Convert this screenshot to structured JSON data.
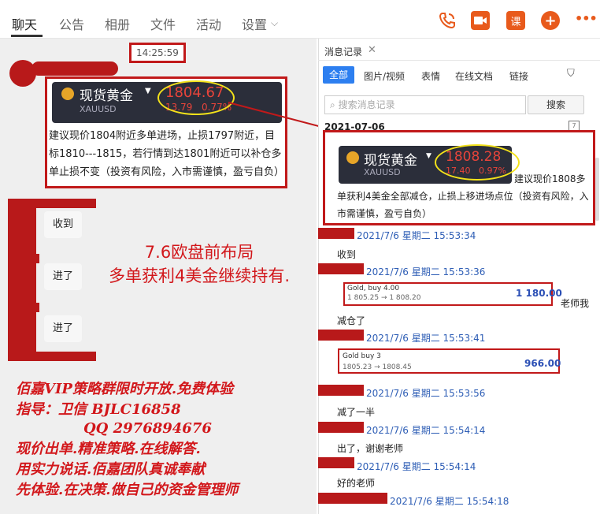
{
  "tabs": [
    "聊天",
    "公告",
    "相册",
    "文件",
    "活动",
    "设置"
  ],
  "tab_active": "聊天",
  "top_icons": {
    "ke": "课",
    "plus": "+",
    "more": "•••"
  },
  "chat": {
    "time": "14:25:59",
    "card": {
      "title": "现货黄金",
      "code": "XAUUSD",
      "price": "1804.67",
      "change": "13.79",
      "pct": "0.77%"
    },
    "message": "建议现价1804附近多单进场，止损1797附近，目标1810---1815，若行情到达1801附近可以补仓多单止损不变（投资有风险，入市需谨慎，盈亏自负）",
    "replies": [
      "收到",
      "进了",
      "进了"
    ],
    "overlay_line1": "7.6欧盘前布局",
    "overlay_line2": "多单获利4美金继续持有.",
    "ad_lines": [
      "佰嘉VIP策略群限时开放.免费体验",
      "指导：卫信 BJLC16858",
      "QQ 2976894676",
      "现价出单.精准策略.在线解答.",
      "用实力说话.佰嘉团队真诚奉献",
      "先体验.在决策.做自己的资金管理师"
    ]
  },
  "history": {
    "title": "消息记录",
    "filters": [
      "全部",
      "图片/视频",
      "表情",
      "在线文档",
      "链接"
    ],
    "search_placeholder": "搜索消息记录",
    "search_btn": "搜索",
    "date": "2021-07-06",
    "card": {
      "title": "现货黄金",
      "code": "XAUUSD",
      "price": "1808.28",
      "change": "17.40",
      "pct": "0.97%"
    },
    "message_a": "建议现价1808多",
    "message_b": "单获利4美金全部减仓，止损上移进场点位（投资有风险，入市需谨慎，盈亏自负）",
    "entries": [
      {
        "ts": "2021/7/6 星期二 15:53:34",
        "text": "收到"
      },
      {
        "ts": "2021/7/6 星期二 15:53:36",
        "text": ""
      },
      {
        "ts": "2021/7/6 星期二 15:53:41",
        "text": "减仓了"
      },
      {
        "ts": "2021/7/6 星期二 15:53:56",
        "text": "减了一半"
      },
      {
        "ts": "2021/7/6 星期二 15:54:14",
        "text": "出了，谢谢老师"
      },
      {
        "ts": "2021/7/6 星期二 15:54:14",
        "text": "好的老师"
      },
      {
        "ts": "2021/7/6 星期二 15:54:18",
        "text": ""
      }
    ],
    "trade1": {
      "line1": "Gold, buy 4.00",
      "line2": "1 805.25 → 1 808.20",
      "amount": "1 180.00",
      "side_text": "老师我"
    },
    "trade2": {
      "line1": "Gold buy 3",
      "line2": "1805.23 → 1808.45",
      "amount": "966.00"
    }
  },
  "colors": {
    "annotation_red": "#c1191a",
    "accent_blue": "#2d7ff0",
    "card_dark": "#2b2e3a"
  }
}
